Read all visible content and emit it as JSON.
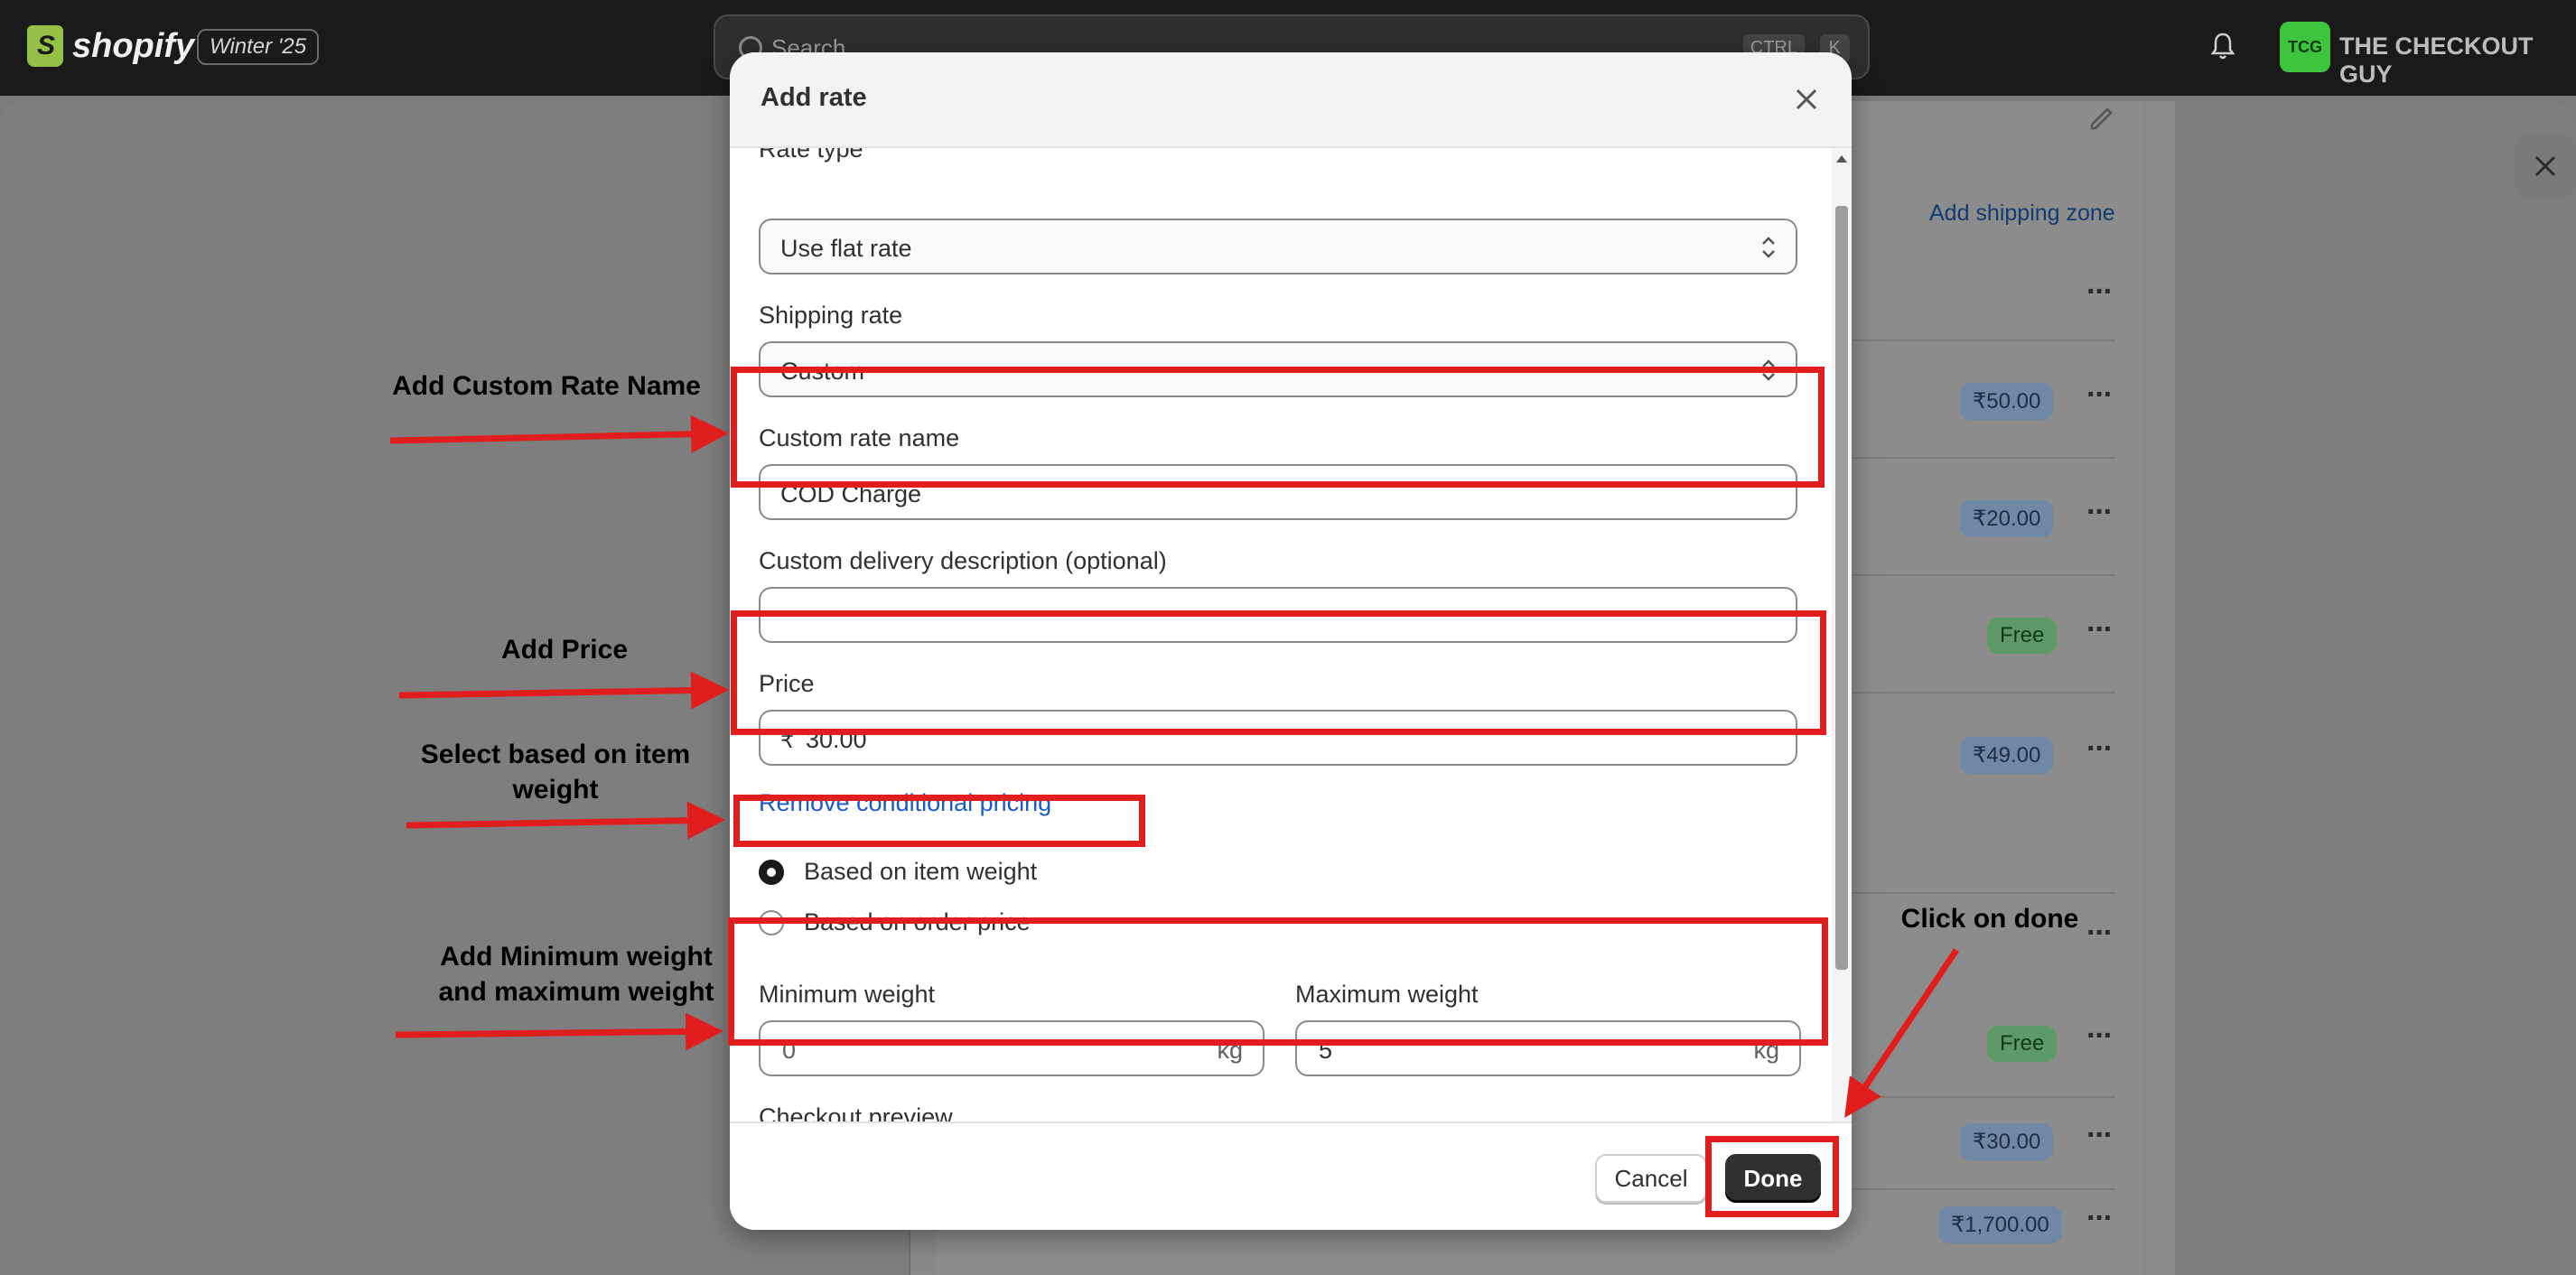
{
  "topbar": {
    "brand": "shopify",
    "edition": "Winter '25",
    "search_placeholder": "Search",
    "shortcut_key1": "CTRL",
    "shortcut_key2": "K",
    "avatar_initials": "TCG",
    "store_name": "THE CHECKOUT GUY"
  },
  "background": {
    "add_zone_link": "Add shipping zone",
    "rates": [
      {
        "badge": "₹50.00",
        "type": "price"
      },
      {
        "badge": "₹20.00",
        "type": "price"
      },
      {
        "badge": "Free",
        "type": "free"
      },
      {
        "badge": "₹49.00",
        "type": "price"
      },
      {
        "badge": "Free",
        "type": "free"
      },
      {
        "badge": "₹30.00",
        "type": "price"
      },
      {
        "badge": "₹1,700.00",
        "type": "price"
      }
    ]
  },
  "modal": {
    "title": "Add rate",
    "rate_type": {
      "label": "Rate type",
      "value": "Use flat rate"
    },
    "shipping_rate": {
      "label": "Shipping rate",
      "value": "Custom"
    },
    "custom_rate_name": {
      "label": "Custom rate name",
      "value": "COD Charge"
    },
    "custom_delivery_description": {
      "label": "Custom delivery description (optional)",
      "value": ""
    },
    "price": {
      "label": "Price",
      "currency": "₹",
      "value": "30.00"
    },
    "remove_conditional_link": "Remove conditional pricing",
    "condition_options": [
      {
        "label": "Based on item weight",
        "selected": true
      },
      {
        "label": "Based on order price",
        "selected": false
      }
    ],
    "min_weight": {
      "label": "Minimum weight",
      "value": "0",
      "unit": "kg"
    },
    "max_weight": {
      "label": "Maximum weight",
      "value": "5",
      "unit": "kg"
    },
    "checkout_preview_label": "Checkout preview",
    "cancel_label": "Cancel",
    "done_label": "Done"
  },
  "annotations": {
    "custom_rate_name": "Add Custom Rate Name",
    "price": "Add Price",
    "weight_select": [
      "Select based on item",
      "weight"
    ],
    "min_max_weight": [
      "Add Minimum weight",
      "and maximum weight"
    ],
    "done": "Click on done"
  },
  "colors": {
    "annotation_red": "#e11d1d",
    "primary_button": "#303030",
    "link_blue": "#1a59c8",
    "avatar_green": "#3ec43e"
  }
}
